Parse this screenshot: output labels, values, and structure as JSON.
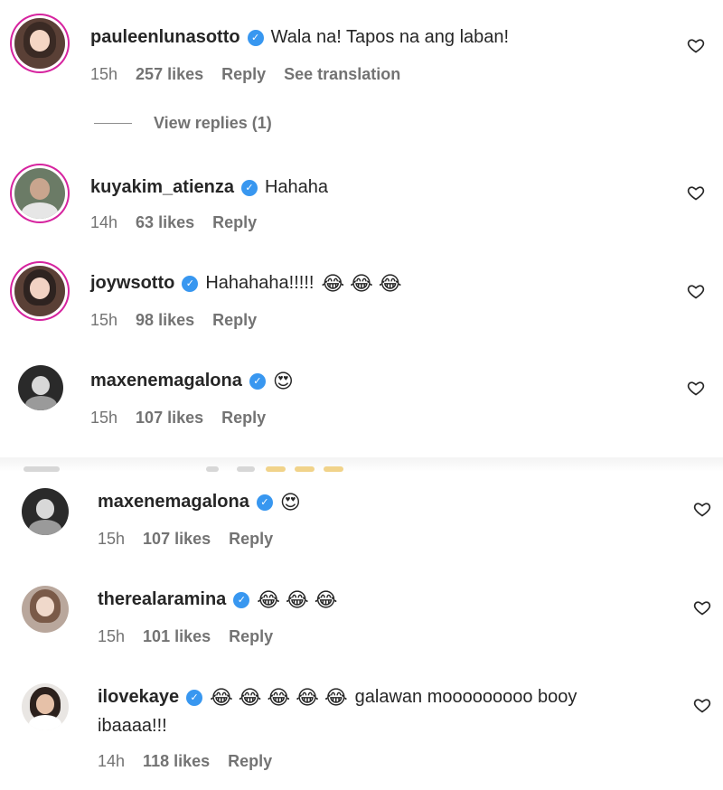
{
  "colors": {
    "link": "#3897f0",
    "meta": "#737373",
    "text": "#262626",
    "ring": "#d6249f"
  },
  "comments": [
    {
      "username": "pauleenlunasotto",
      "text": "Wala na! Tapos na ang laban!",
      "emojis": [],
      "time": "15h",
      "likes": "257 likes",
      "reply": "Reply",
      "translation": "See translation"
    },
    {
      "username": "kuyakim_atienza",
      "text": "Hahaha",
      "emojis": [],
      "time": "14h",
      "likes": "63 likes",
      "reply": "Reply"
    },
    {
      "username": "joywsotto",
      "text": "Hahahaha!!!!!",
      "emojis": [
        "😂",
        "😂",
        "😂"
      ],
      "time": "15h",
      "likes": "98 likes",
      "reply": "Reply"
    },
    {
      "username": "maxenemagalona",
      "text": "",
      "emojis": [
        "😍"
      ],
      "time": "15h",
      "likes": "107 likes",
      "reply": "Reply"
    },
    {
      "username": "maxenemagalona",
      "text": "",
      "emojis": [
        "😍"
      ],
      "time": "15h",
      "likes": "107 likes",
      "reply": "Reply"
    },
    {
      "username": "therealaramina",
      "text": "",
      "emojis": [
        "😂",
        "😂",
        "😂"
      ],
      "time": "15h",
      "likes": "101 likes",
      "reply": "Reply"
    },
    {
      "username": "ilovekaye",
      "text": "galawan mooooooooo booy",
      "text2": "ibaaaa!!!",
      "emojis": [
        "😂",
        "😂",
        "😂",
        "😂",
        "😂"
      ],
      "time": "14h",
      "likes": "118 likes",
      "reply": "Reply"
    }
  ],
  "view_replies": {
    "label": "View replies (1)"
  },
  "icons": {
    "heart": "heart-outline-icon",
    "verified": "verified-badge-icon"
  }
}
